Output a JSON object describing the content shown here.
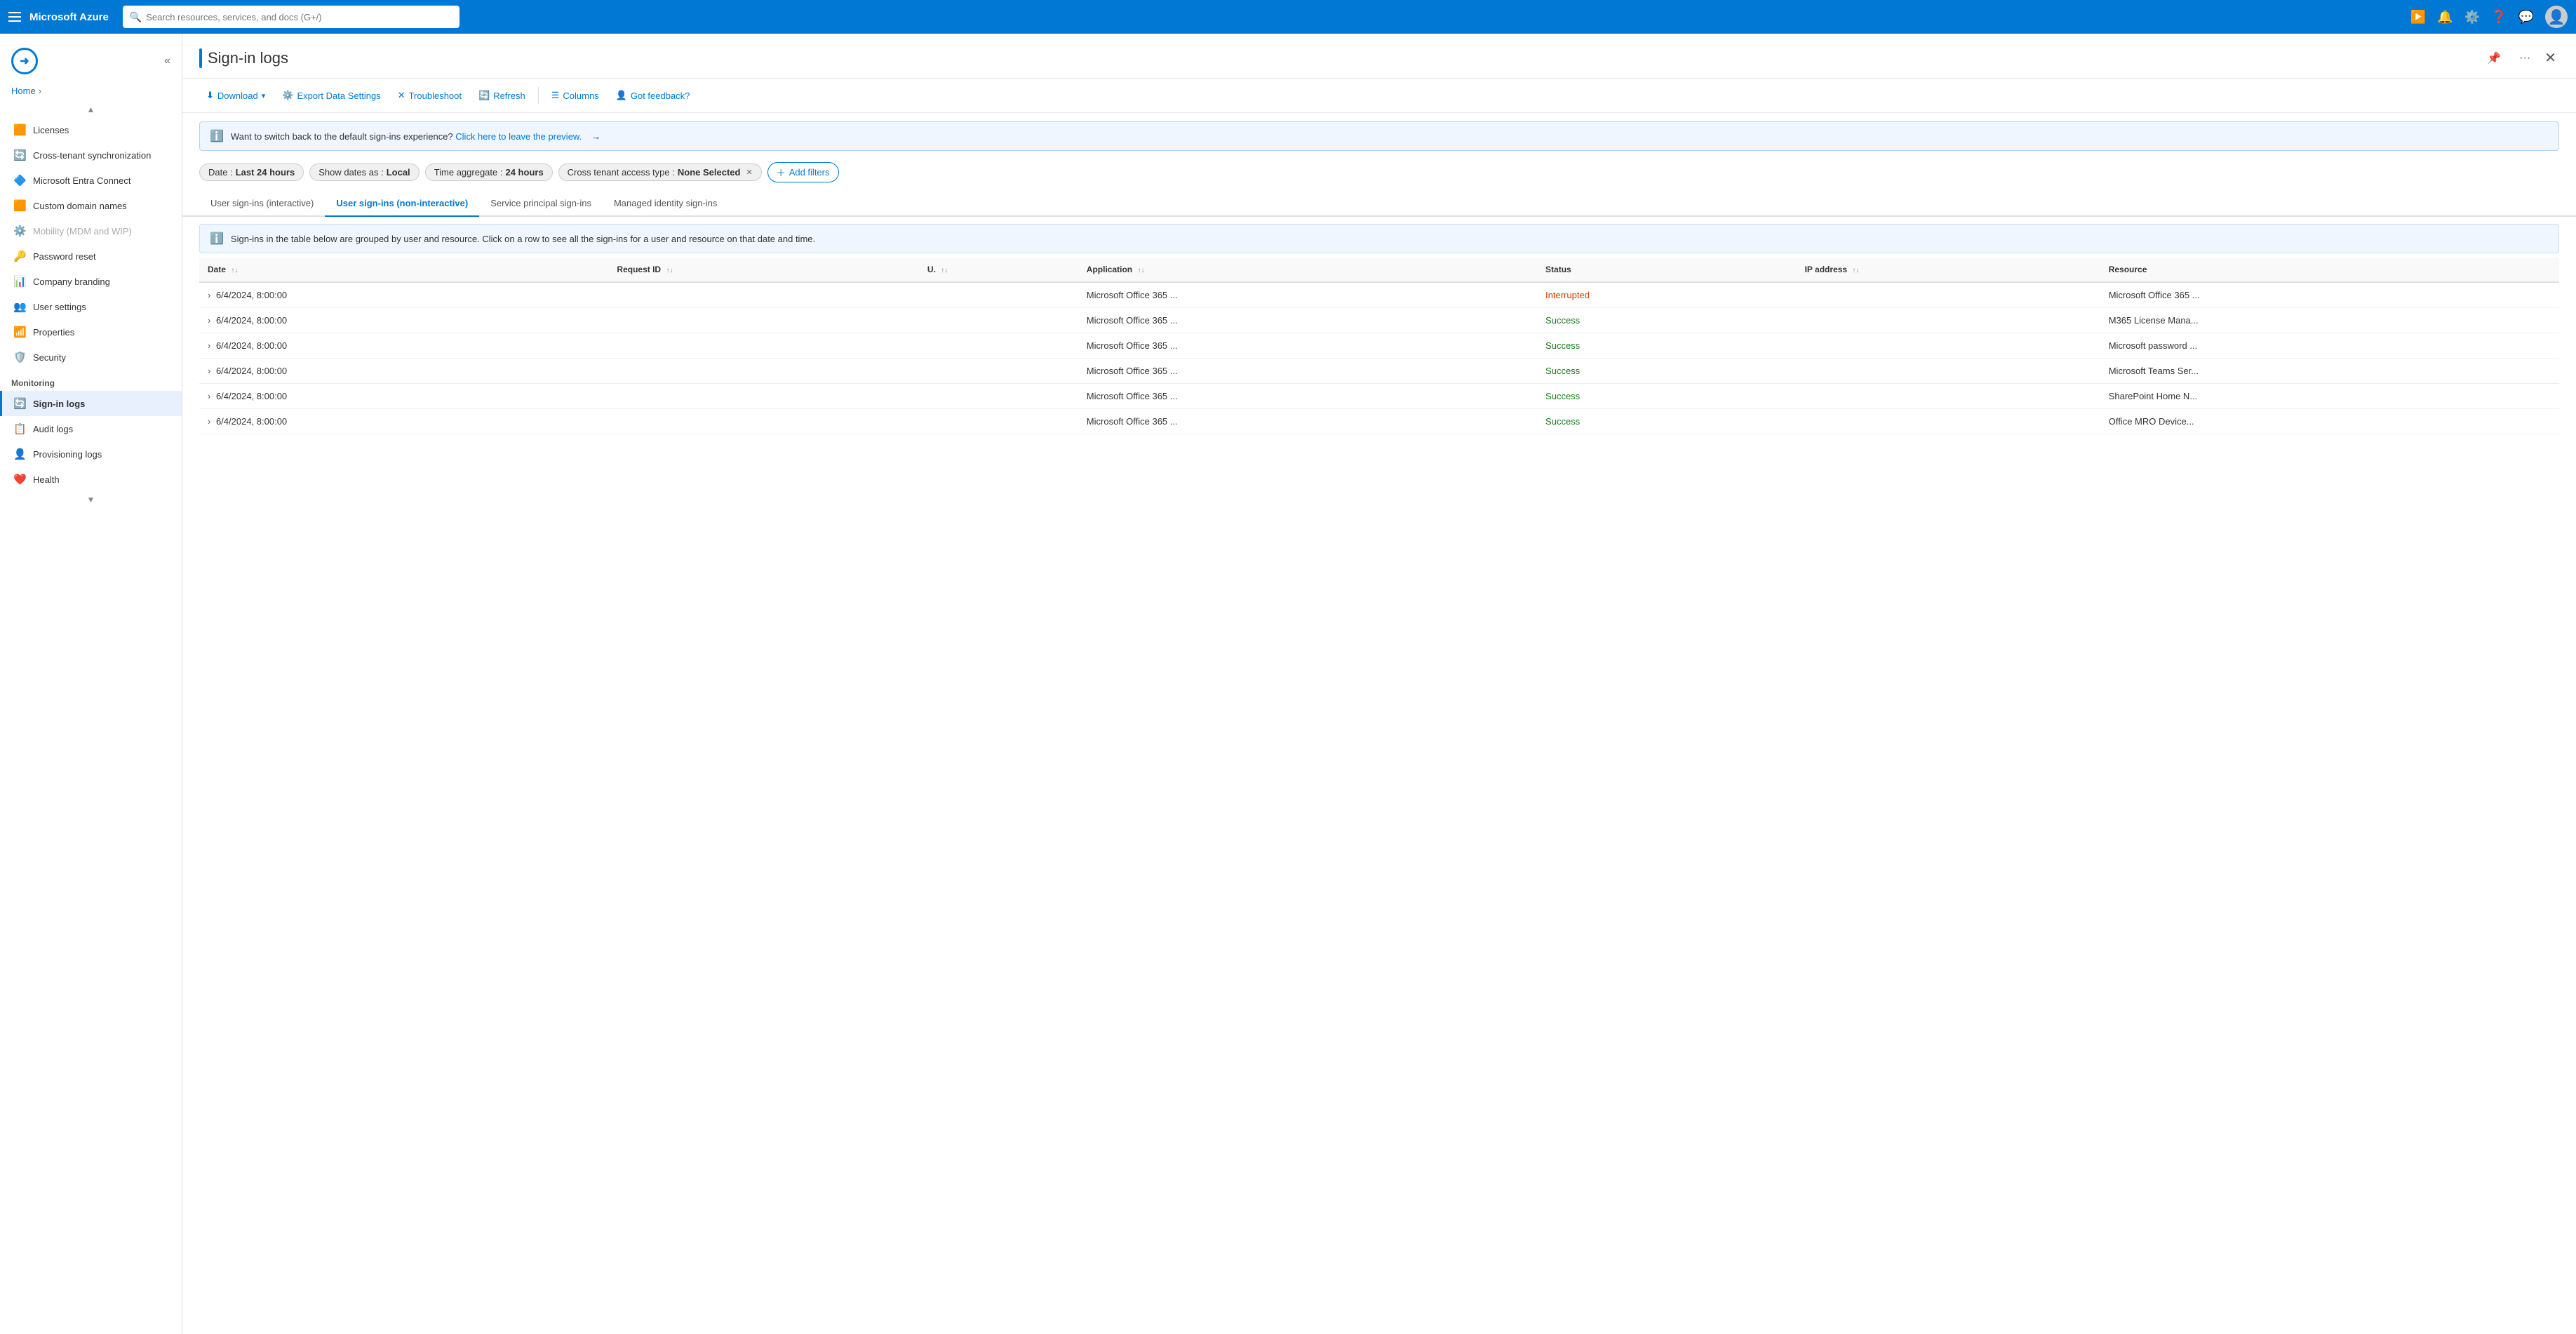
{
  "topnav": {
    "brand": "Microsoft Azure",
    "search_placeholder": "Search resources, services, and docs (G+/)"
  },
  "breadcrumb": {
    "home": "Home"
  },
  "sidebar": {
    "collapse_tooltip": "Collapse sidebar",
    "items_above": [
      {
        "id": "licenses",
        "label": "Licenses",
        "icon": "🟧"
      },
      {
        "id": "cross-tenant-sync",
        "label": "Cross-tenant synchronization",
        "icon": "⚙️"
      },
      {
        "id": "ms-entra-connect",
        "label": "Microsoft Entra Connect",
        "icon": "🔷"
      },
      {
        "id": "custom-domain",
        "label": "Custom domain names",
        "icon": "🟧"
      },
      {
        "id": "mobility",
        "label": "Mobility (MDM and WIP)",
        "icon": "⚙️",
        "disabled": true
      },
      {
        "id": "password-reset",
        "label": "Password reset",
        "icon": "🔑"
      },
      {
        "id": "company-branding",
        "label": "Company branding",
        "icon": "📊"
      },
      {
        "id": "user-settings",
        "label": "User settings",
        "icon": "👥"
      },
      {
        "id": "properties",
        "label": "Properties",
        "icon": "📶"
      },
      {
        "id": "security",
        "label": "Security",
        "icon": "🛡️"
      }
    ],
    "monitoring_header": "Monitoring",
    "monitoring_items": [
      {
        "id": "sign-in-logs",
        "label": "Sign-in logs",
        "icon": "🔄",
        "active": true
      },
      {
        "id": "audit-logs",
        "label": "Audit logs",
        "icon": "📋"
      },
      {
        "id": "provisioning-logs",
        "label": "Provisioning logs",
        "icon": "👤"
      },
      {
        "id": "health",
        "label": "Health",
        "icon": "❤️"
      }
    ]
  },
  "panel": {
    "title": "Sign-in logs",
    "pin_tooltip": "Pin",
    "more_tooltip": "More options",
    "close_tooltip": "Close"
  },
  "toolbar": {
    "download_label": "Download",
    "export_settings_label": "Export Data Settings",
    "troubleshoot_label": "Troubleshoot",
    "refresh_label": "Refresh",
    "columns_label": "Columns",
    "feedback_label": "Got feedback?"
  },
  "info_banner": {
    "text": "Want to switch back to the default sign-ins experience? Click here to leave the preview.",
    "arrow": "→"
  },
  "filters": {
    "date_label": "Date",
    "date_value": "Last 24 hours",
    "show_dates_label": "Show dates as",
    "show_dates_value": "Local",
    "time_aggregate_label": "Time aggregate",
    "time_aggregate_value": "24 hours",
    "cross_tenant_label": "Cross tenant access type",
    "cross_tenant_value": "None Selected",
    "add_filter_label": "Add filters"
  },
  "tabs": [
    {
      "id": "interactive",
      "label": "User sign-ins (interactive)",
      "active": false
    },
    {
      "id": "non-interactive",
      "label": "User sign-ins (non-interactive)",
      "active": true
    },
    {
      "id": "service-principal",
      "label": "Service principal sign-ins",
      "active": false
    },
    {
      "id": "managed-identity",
      "label": "Managed identity sign-ins",
      "active": false
    }
  ],
  "table_info": {
    "text": "Sign-ins in the table below are grouped by user and resource. Click on a row to see all the sign-ins for a user and resource on that date and time."
  },
  "table": {
    "columns": [
      {
        "id": "date",
        "label": "Date",
        "sortable": true
      },
      {
        "id": "request-id",
        "label": "Request ID",
        "sortable": true
      },
      {
        "id": "user",
        "label": "U.",
        "sortable": true
      },
      {
        "id": "application",
        "label": "Application",
        "sortable": true
      },
      {
        "id": "status",
        "label": "Status",
        "sortable": false
      },
      {
        "id": "ip-address",
        "label": "IP address",
        "sortable": true
      },
      {
        "id": "resource",
        "label": "Resource",
        "sortable": false
      }
    ],
    "rows": [
      {
        "date": "6/4/2024, 8:00:00",
        "request_id": "",
        "user": "",
        "application": "Microsoft Office 365 ...",
        "status": "Interrupted",
        "status_class": "status-interrupted",
        "ip_address": "",
        "resource": "Microsoft Office 365 ..."
      },
      {
        "date": "6/4/2024, 8:00:00",
        "request_id": "",
        "user": "",
        "application": "Microsoft Office 365 ...",
        "status": "Success",
        "status_class": "status-success",
        "ip_address": "",
        "resource": "M365 License Mana..."
      },
      {
        "date": "6/4/2024, 8:00:00",
        "request_id": "",
        "user": "",
        "application": "Microsoft Office 365 ...",
        "status": "Success",
        "status_class": "status-success",
        "ip_address": "",
        "resource": "Microsoft password ..."
      },
      {
        "date": "6/4/2024, 8:00:00",
        "request_id": "",
        "user": "",
        "application": "Microsoft Office 365 ...",
        "status": "Success",
        "status_class": "status-success",
        "ip_address": "",
        "resource": "Microsoft Teams Ser..."
      },
      {
        "date": "6/4/2024, 8:00:00",
        "request_id": "",
        "user": "",
        "application": "Microsoft Office 365 ...",
        "status": "Success",
        "status_class": "status-success",
        "ip_address": "",
        "resource": "SharePoint Home N..."
      },
      {
        "date": "6/4/2024, 8:00:00",
        "request_id": "",
        "user": "",
        "application": "Microsoft Office 365 ...",
        "status": "Success",
        "status_class": "status-success",
        "ip_address": "",
        "resource": "Office MRO Device..."
      }
    ]
  }
}
